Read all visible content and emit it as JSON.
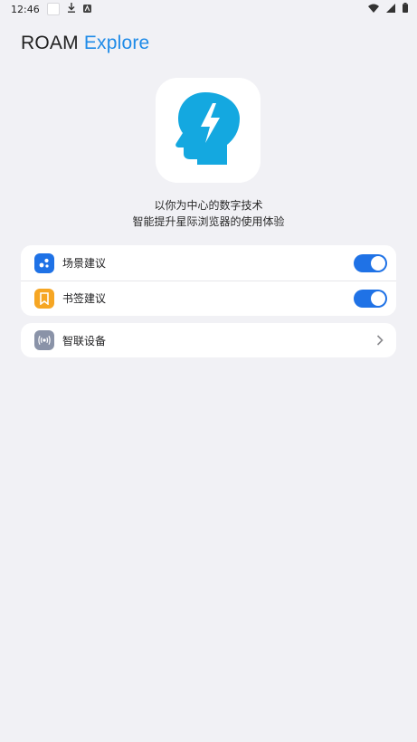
{
  "status_bar": {
    "time": "12:46",
    "icons": [
      "notification-box",
      "download-icon",
      "app-notification-icon",
      "wifi-icon",
      "signal-icon",
      "battery-icon"
    ]
  },
  "header": {
    "brand": "ROAM",
    "accent": "Explore",
    "accent_color": "#1f8be8"
  },
  "logo": {
    "icon": "head-lightning-icon",
    "color": "#14a8e0"
  },
  "tagline": {
    "line1": "以你为中心的数字技术",
    "line2": "智能提升星际浏览器的使用体验"
  },
  "settings": {
    "toggles": [
      {
        "label": "场景建议",
        "icon": "scene-suggestion-icon",
        "icon_color": "#1f72e6",
        "enabled": true
      },
      {
        "label": "书签建议",
        "icon": "bookmark-icon",
        "icon_color": "#f6a623",
        "enabled": true
      }
    ],
    "links": [
      {
        "label": "智联设备",
        "icon": "smart-device-icon",
        "icon_color": "#8a93a8"
      }
    ]
  },
  "colors": {
    "background": "#f1f1f5",
    "toggle_on": "#1f72e6"
  }
}
